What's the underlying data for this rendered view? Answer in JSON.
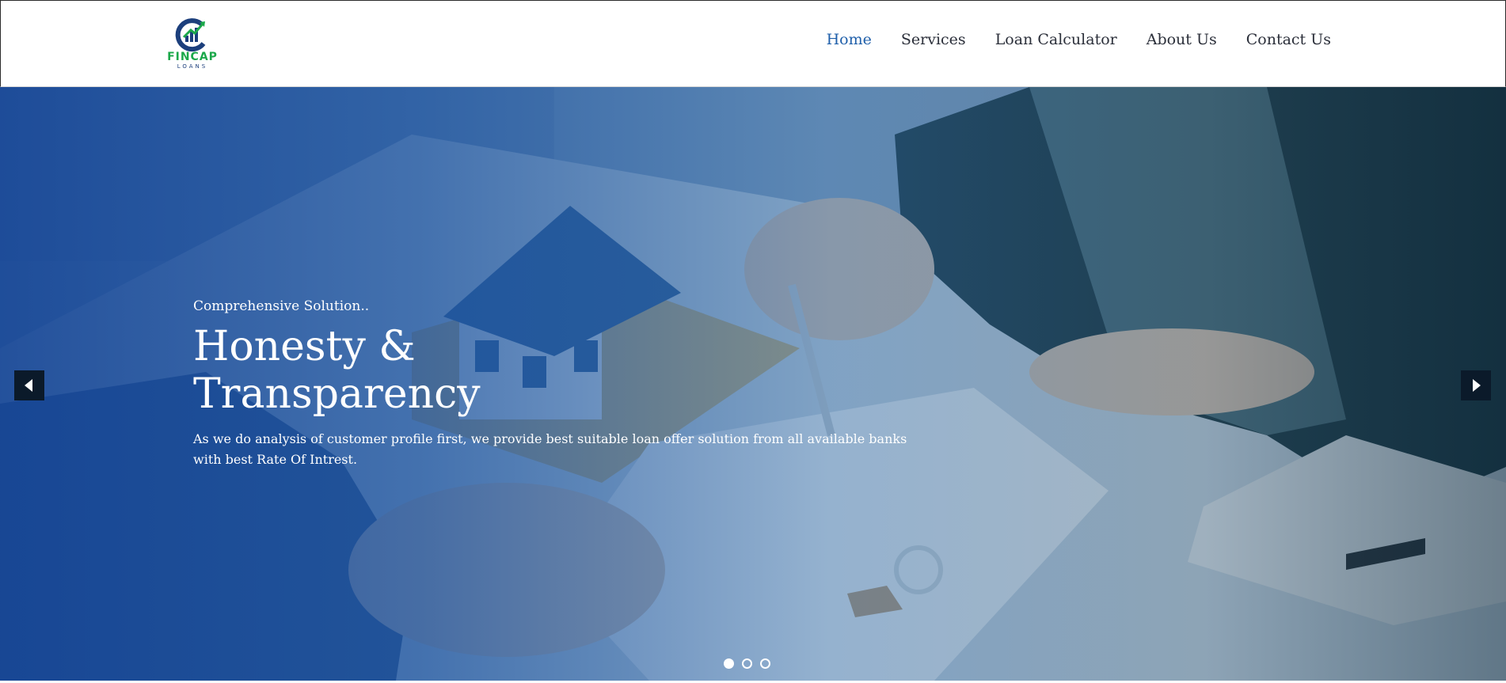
{
  "brand": {
    "name": "FINCAP",
    "sub": "LOANS",
    "logo_icon": "fincap-logo-icon",
    "colors": {
      "green": "#1ba84a",
      "navy": "#1c3f7c"
    }
  },
  "nav": {
    "items": [
      {
        "label": "Home",
        "active": true
      },
      {
        "label": "Services",
        "active": false
      },
      {
        "label": "Loan Calculator",
        "active": false
      },
      {
        "label": "About Us",
        "active": false
      },
      {
        "label": "Contact Us",
        "active": false
      }
    ],
    "active_color": "#1f5faa",
    "text_color": "#2b2f3a"
  },
  "hero": {
    "kicker": "Comprehensive Solution..",
    "title_line1": "Honesty &",
    "title_line2": "Transparency",
    "description": "As we do analysis of customer profile first, we provide best suitable loan offer solution from all available banks with best Rate Of Intrest.",
    "prev_icon": "chevron-left-icon",
    "next_icon": "chevron-right-icon",
    "slides": [
      {
        "active": true
      },
      {
        "active": false
      },
      {
        "active": false
      }
    ],
    "overlay_color": "#1646a0"
  }
}
